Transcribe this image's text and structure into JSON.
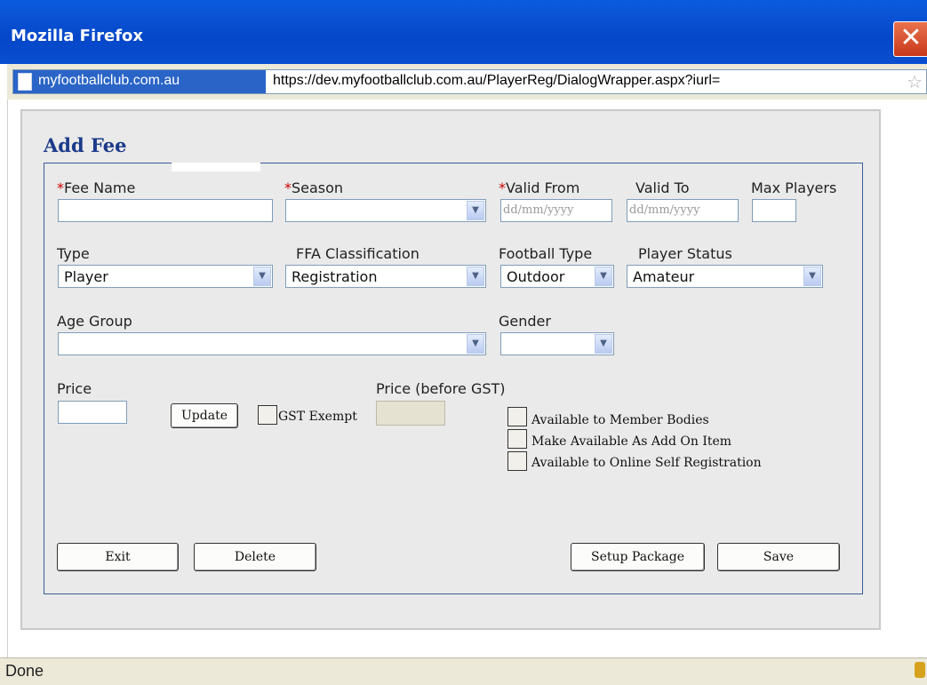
{
  "window": {
    "title": "Mozilla Firefox",
    "close_glyph": "✕"
  },
  "urlbar": {
    "site": "myfootballclub.com.au",
    "url": "https://dev.myfootballclub.com.au/PlayerReg/DialogWrapper.aspx?iurl="
  },
  "form": {
    "title": "Add Fee",
    "required_marker": "*",
    "fee_name": {
      "label": "Fee Name",
      "value": ""
    },
    "season": {
      "label": "Season",
      "value": ""
    },
    "valid_from": {
      "label": "Valid From",
      "placeholder": "dd/mm/yyyy"
    },
    "valid_to": {
      "label": "Valid To",
      "placeholder": "dd/mm/yyyy"
    },
    "max_players": {
      "label": "Max Players",
      "value": ""
    },
    "type": {
      "label": "Type",
      "value": "Player"
    },
    "ffa_classification": {
      "label": "FFA Classification",
      "value": "Registration"
    },
    "football_type": {
      "label": "Football Type",
      "value": "Outdoor"
    },
    "player_status": {
      "label": "Player Status",
      "value": "Amateur"
    },
    "age_group": {
      "label": "Age Group",
      "value": ""
    },
    "gender": {
      "label": "Gender",
      "value": ""
    },
    "price": {
      "label": "Price",
      "value": ""
    },
    "update_button": "Update",
    "gst_exempt": {
      "label": "GST Exempt",
      "checked": false
    },
    "price_before_gst": {
      "label": "Price (before GST)",
      "value": ""
    },
    "options": [
      {
        "label": "Available to Member Bodies",
        "checked": false
      },
      {
        "label": "Make Available As Add On Item",
        "checked": false
      },
      {
        "label": "Available to Online Self Registration",
        "checked": false
      }
    ],
    "buttons": {
      "exit": "Exit",
      "delete": "Delete",
      "setup_package": "Setup Package",
      "save": "Save"
    }
  },
  "status": {
    "text": "Done"
  },
  "icons": {
    "dropdown_arrow": "▼",
    "star": "☆"
  }
}
